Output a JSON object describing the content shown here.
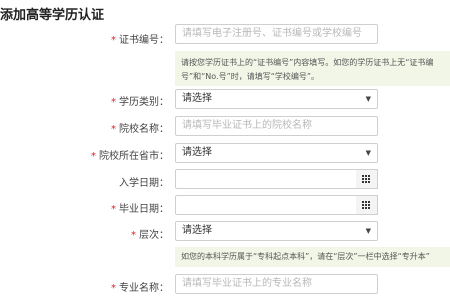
{
  "page": {
    "title": "添加高等学历认证"
  },
  "certificate_number": {
    "label": "证书编号：",
    "placeholder": "请填写电子注册号、证书编号或学校编号",
    "hint": {
      "line1": "请按您学历证书上的“证书编号”内容填写。如您的学历证书上无“证书编",
      "line2": "号”和“No.号”时，请填写“学校编号”。"
    }
  },
  "education_type": {
    "label": "学历类别：",
    "value": "请选择"
  },
  "school_name": {
    "label": "院校名称：",
    "placeholder": "请填写毕业证书上的院校名称"
  },
  "school_province": {
    "label": "院校所在省市：",
    "value": "请选择"
  },
  "enrollment_date": {
    "label": "入学日期："
  },
  "graduation_date": {
    "label": "毕业日期："
  },
  "level": {
    "label": "层次：",
    "value": "请选择",
    "hint": "如您的本科学历属于“专科起点本科”，请在“层次”一栏中选择“专升本”"
  },
  "major_name": {
    "label": "专业名称：",
    "placeholder": "请填写毕业证书上的专业名称"
  },
  "symbols": {
    "required": "*",
    "caret": "▼"
  }
}
